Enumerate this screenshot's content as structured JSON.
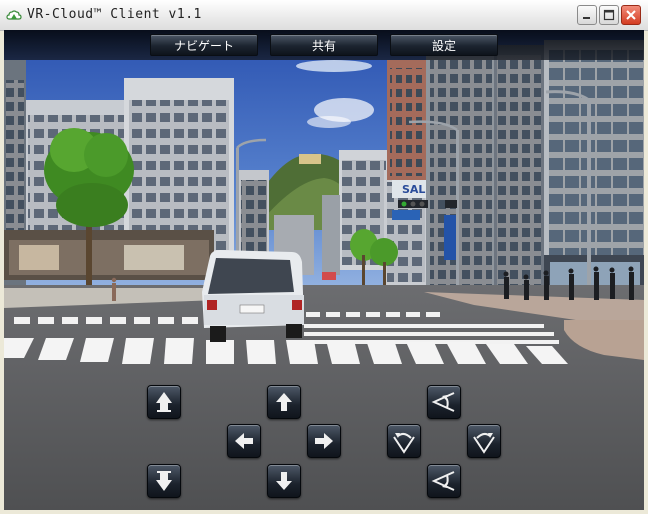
{
  "window": {
    "title": "VR-Cloud™ Client v1.1",
    "minimize_icon": "minimize-icon",
    "maximize_icon": "maximize-icon",
    "close_icon": "close-icon"
  },
  "menu": {
    "navigate_label": "ナビゲート",
    "share_label": "共有",
    "settings_label": "設定"
  },
  "scene": {
    "signs": {
      "sal": "SAL"
    }
  },
  "controls": {
    "forward_fast": "up-arrow-heavy-icon",
    "forward": "up-arrow-icon",
    "left": "left-arrow-icon",
    "right": "right-arrow-icon",
    "back_fast": "down-arrow-heavy-icon",
    "back": "down-arrow-icon",
    "turn_left": "rotate-left-icon",
    "turn_right": "rotate-right-icon",
    "look_up": "tilt-up-icon",
    "look_down": "tilt-down-icon"
  },
  "colors": {
    "sky": "#3f66b8",
    "road": "#5d5d5f",
    "toolbar": "#10151c"
  }
}
